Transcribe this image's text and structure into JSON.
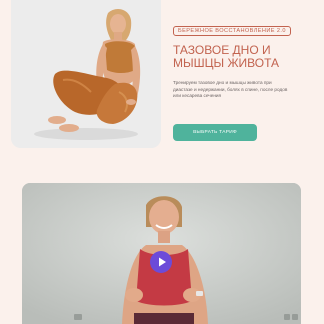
{
  "hero": {
    "badge": "БЕРЕЖНОЕ ВОССТАНОВЛЕНИЕ 2.0",
    "title": "ТАЗОВОЕ ДНО И МЫШЦЫ ЖИВОТА",
    "description": "Тренируем тазовое дно и мышцы живота при диастазе и недержании, болях в спине, после родов или кесарева сечения",
    "cta_label": "ВЫБРАТЬ ТАРИФ"
  },
  "colors": {
    "accent": "#c2634f",
    "button": "#4fb39c",
    "play": "#6c4bd9",
    "background": "#fbf1ec"
  },
  "icons": {
    "play": "play-icon",
    "settings": "settings-icon",
    "fullscreen": "fullscreen-icon"
  }
}
